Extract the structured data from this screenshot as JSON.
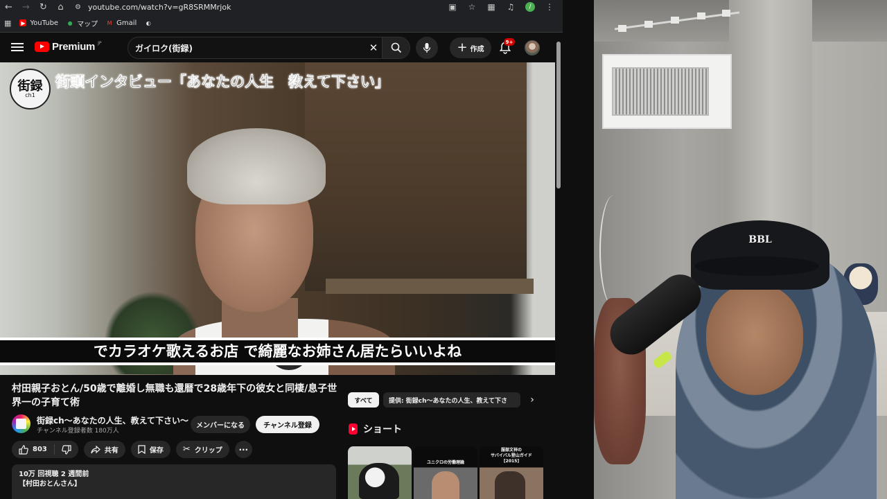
{
  "browser": {
    "url": "youtube.com/watch?v=gR8SRMMrjok",
    "profile_initial": "/",
    "bookmarks": [
      {
        "label": "YouTube",
        "icon": "youtube-icon",
        "color": "#ff0000"
      },
      {
        "label": "マップ",
        "icon": "maps-icon",
        "color": "#34a853"
      },
      {
        "label": "Gmail",
        "icon": "gmail-icon",
        "color": "#ea4335"
      },
      {
        "label": "",
        "icon": "globe-icon",
        "color": "#e3e3e3"
      }
    ]
  },
  "header": {
    "logo_text": "Premium",
    "logo_region": "JP",
    "search_value": "ガイロク(街録)",
    "create_label": "作成",
    "notification_count": "9+"
  },
  "video": {
    "logo_main": "街録",
    "logo_sub": "ch1",
    "overlay_title": "街頭インタビュー「あなたの人生　教えて下さい」",
    "subtitle": "でカラオケ歌えるお店 で綺麗なお姉さん居たらいいよね"
  },
  "info": {
    "title": "村田親子おとん/50歳で離婚し無職も還暦で28歳年下の彼女と同棲/息子世界一の子育て術",
    "channel_name": "街録ch〜あなたの人生、教えて下さい〜",
    "subscribers": "チャンネル登録者数 180万人",
    "member_label": "メンバーになる",
    "subscribe_label": "チャンネル登録",
    "like_count": "803",
    "share_label": "共有",
    "save_label": "保存",
    "clip_label": "クリップ",
    "views_time": "10万 回視聴  2 週間前",
    "description_first": "【村田おとんさん】"
  },
  "sidebar": {
    "chip_all": "すべて",
    "chip_provider": "提供: 街録ch〜あなたの人生、教えて下さ",
    "shorts_title": "ショート",
    "shorts": [
      {
        "caption": ""
      },
      {
        "caption": "ユニクロの労働理論"
      },
      {
        "caption": "服部文祥の\nサバイバル登山ガイド\n[2015]"
      }
    ]
  },
  "webcam": {
    "cap_logo": "BBL"
  },
  "colors": {
    "accent_red": "#ff0000",
    "background": "#0f0f0f",
    "button_bg": "#272727"
  }
}
